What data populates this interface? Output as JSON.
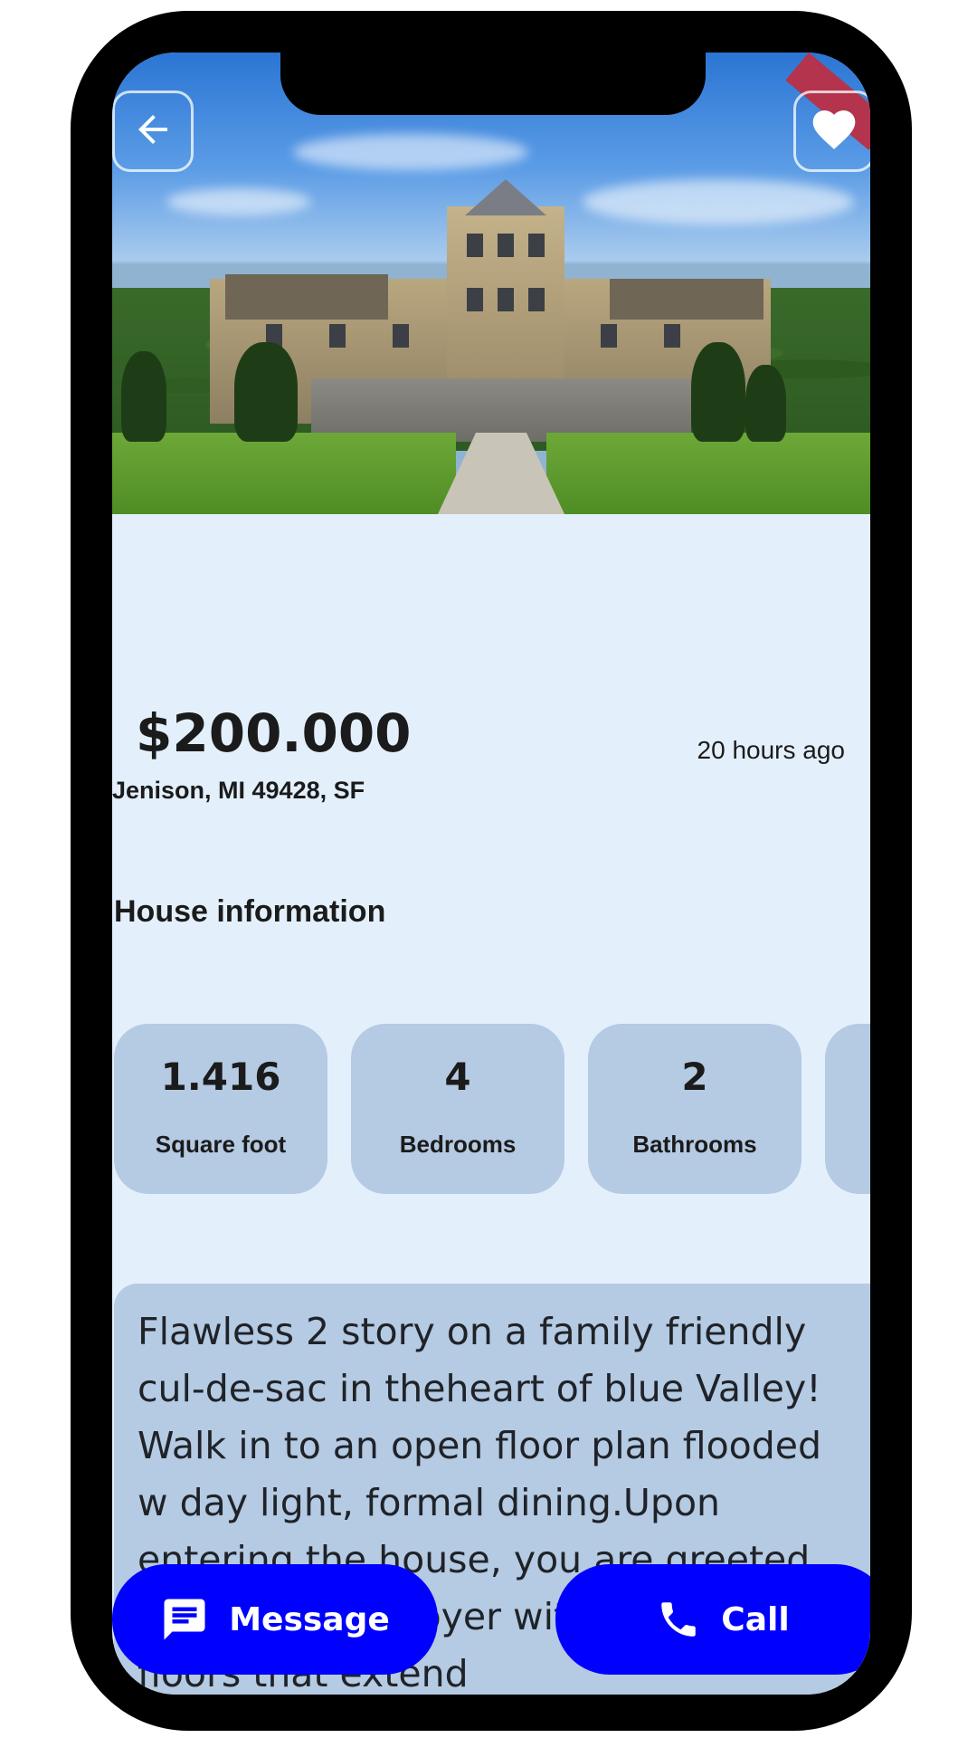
{
  "listing": {
    "price": "$200.000",
    "address": "Jenison, MI 49428, SF",
    "posted": "20 hours ago"
  },
  "house_info": {
    "title": "House information",
    "stats": [
      {
        "value": "1.416",
        "label": "Square foot"
      },
      {
        "value": "4",
        "label": "Bedrooms"
      },
      {
        "value": "2",
        "label": "Bathrooms"
      }
    ]
  },
  "description": "Flawless 2 story on a family friendly cul-de-sac in theheart of blue Valley! Walk in to an open floor plan flooded w day light, formal dining.Upon entering the house, you are greeted by a beautiful foyer with hardwood floors that extend",
  "actions": {
    "message_label": "Message",
    "call_label": "Call"
  },
  "icons": {
    "back": "arrow-left-icon",
    "favorite": "heart-icon",
    "message": "chat-bubble-icon",
    "call": "phone-icon"
  },
  "colors": {
    "background": "#e3f0fc",
    "card": "#b5cae3",
    "accent": "#0000ff"
  }
}
